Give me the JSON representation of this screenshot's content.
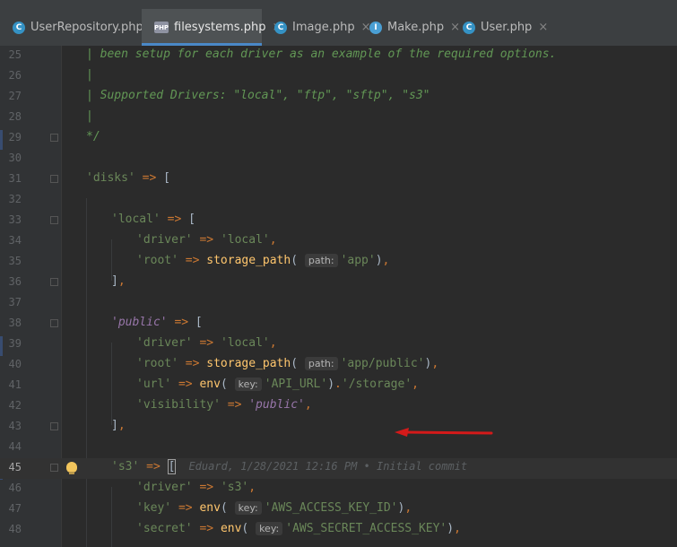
{
  "tabs": [
    {
      "label": "UserRepository.php",
      "icon": "class-icon",
      "active": false
    },
    {
      "label": "filesystems.php",
      "icon": "php-file-icon",
      "active": true
    },
    {
      "label": "Image.php",
      "icon": "class-icon",
      "active": false
    },
    {
      "label": "Make.php",
      "icon": "interface-icon",
      "active": false
    },
    {
      "label": "User.php",
      "icon": "class-icon",
      "active": false
    }
  ],
  "close_glyph": "×",
  "lines": [
    {
      "n": "25",
      "t": "| been setup for each driver as an example of the required options."
    },
    {
      "n": "26",
      "t": "|"
    },
    {
      "n": "27",
      "t": "| Supported Drivers: \"local\", \"ftp\", \"sftp\", \"s3\""
    },
    {
      "n": "28",
      "t": "|"
    },
    {
      "n": "29",
      "t": "*/"
    },
    {
      "n": "30",
      "t": ""
    },
    {
      "n": "31",
      "t": "'disks' => ["
    },
    {
      "n": "32",
      "t": ""
    },
    {
      "n": "33",
      "t": "'local' => ["
    },
    {
      "n": "34",
      "t": "'driver' => 'local',"
    },
    {
      "n": "35",
      "t": "'root' => storage_path( path: 'app'),"
    },
    {
      "n": "36",
      "t": "],"
    },
    {
      "n": "37",
      "t": ""
    },
    {
      "n": "38",
      "t": "'public' => ["
    },
    {
      "n": "39",
      "t": "'driver' => 'local',"
    },
    {
      "n": "40",
      "t": "'root' => storage_path( path: 'app/public'),"
    },
    {
      "n": "41",
      "t": "'url' => env( key: 'API_URL').'/storage',"
    },
    {
      "n": "42",
      "t": "'visibility' => 'public',"
    },
    {
      "n": "43",
      "t": "],"
    },
    {
      "n": "44",
      "t": ""
    },
    {
      "n": "45",
      "t": "'s3' => [",
      "blame": "Eduard, 1/28/2021 12:16 PM • Initial commit"
    },
    {
      "n": "46",
      "t": "'driver' => 's3',"
    },
    {
      "n": "47",
      "t": "'key' => env( key: 'AWS_ACCESS_KEY_ID'),"
    },
    {
      "n": "48",
      "t": "'secret' => env( key: 'AWS_SECRET_ACCESS_KEY'),"
    }
  ],
  "current_line": "45",
  "hint_labels": {
    "path": "path:",
    "key": "key:"
  },
  "colors": {
    "arrow": "#d41a1a",
    "active_tab_underline": "#4a88c7"
  }
}
